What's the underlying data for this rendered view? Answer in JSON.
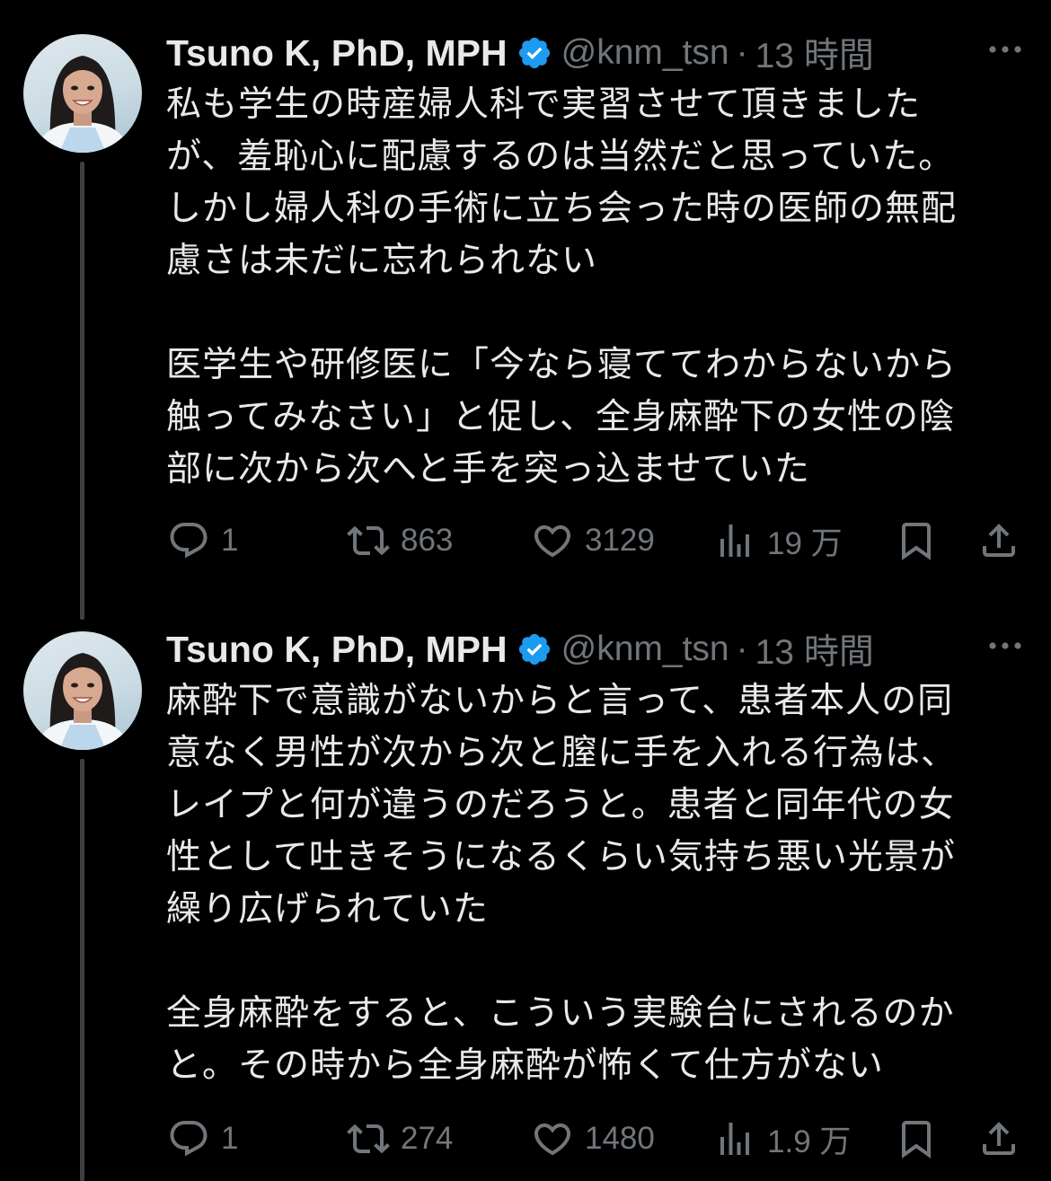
{
  "colors": {
    "background": "#000000",
    "text": "#e7e9ea",
    "secondary": "#71767b",
    "verified": "#1d9bf0",
    "thread_line": "#3e4144"
  },
  "tweets": [
    {
      "author": {
        "name": "Tsuno K, PhD, MPH",
        "handle": "@knm_tsn",
        "verified_icon": "verified-badge-icon"
      },
      "separator": "·",
      "time": "13 時間",
      "text": "私も学生の時産婦人科で実習させて頂きました\nが、羞恥心に配慮するのは当然だと思っていた。\nしかし婦人科の手術に立ち会った時の医師の無配\n慮さは未だに忘れられない\n\n医学生や研修医に「今なら寝ててわからないから\n触ってみなさい」と促し、全身麻酔下の女性の陰\n部に次から次へと手を突っ込ませていた",
      "stats": {
        "replies": "1",
        "retweets": "863",
        "likes": "3129",
        "views": "19 万"
      }
    },
    {
      "author": {
        "name": "Tsuno K, PhD, MPH",
        "handle": "@knm_tsn",
        "verified_icon": "verified-badge-icon"
      },
      "separator": "·",
      "time": "13 時間",
      "text": "麻酔下で意識がないからと言って、患者本人の同\n意なく男性が次から次と膣に手を入れる行為は、\nレイプと何が違うのだろうと。患者と同年代の女\n性として吐きそうになるくらい気持ち悪い光景が\n繰り広げられていた\n\n全身麻酔をすると、こういう実験台にされるのか\nと。その時から全身麻酔が怖くて仕方がない",
      "stats": {
        "replies": "1",
        "retweets": "274",
        "likes": "1480",
        "views": "1.9 万"
      }
    }
  ]
}
